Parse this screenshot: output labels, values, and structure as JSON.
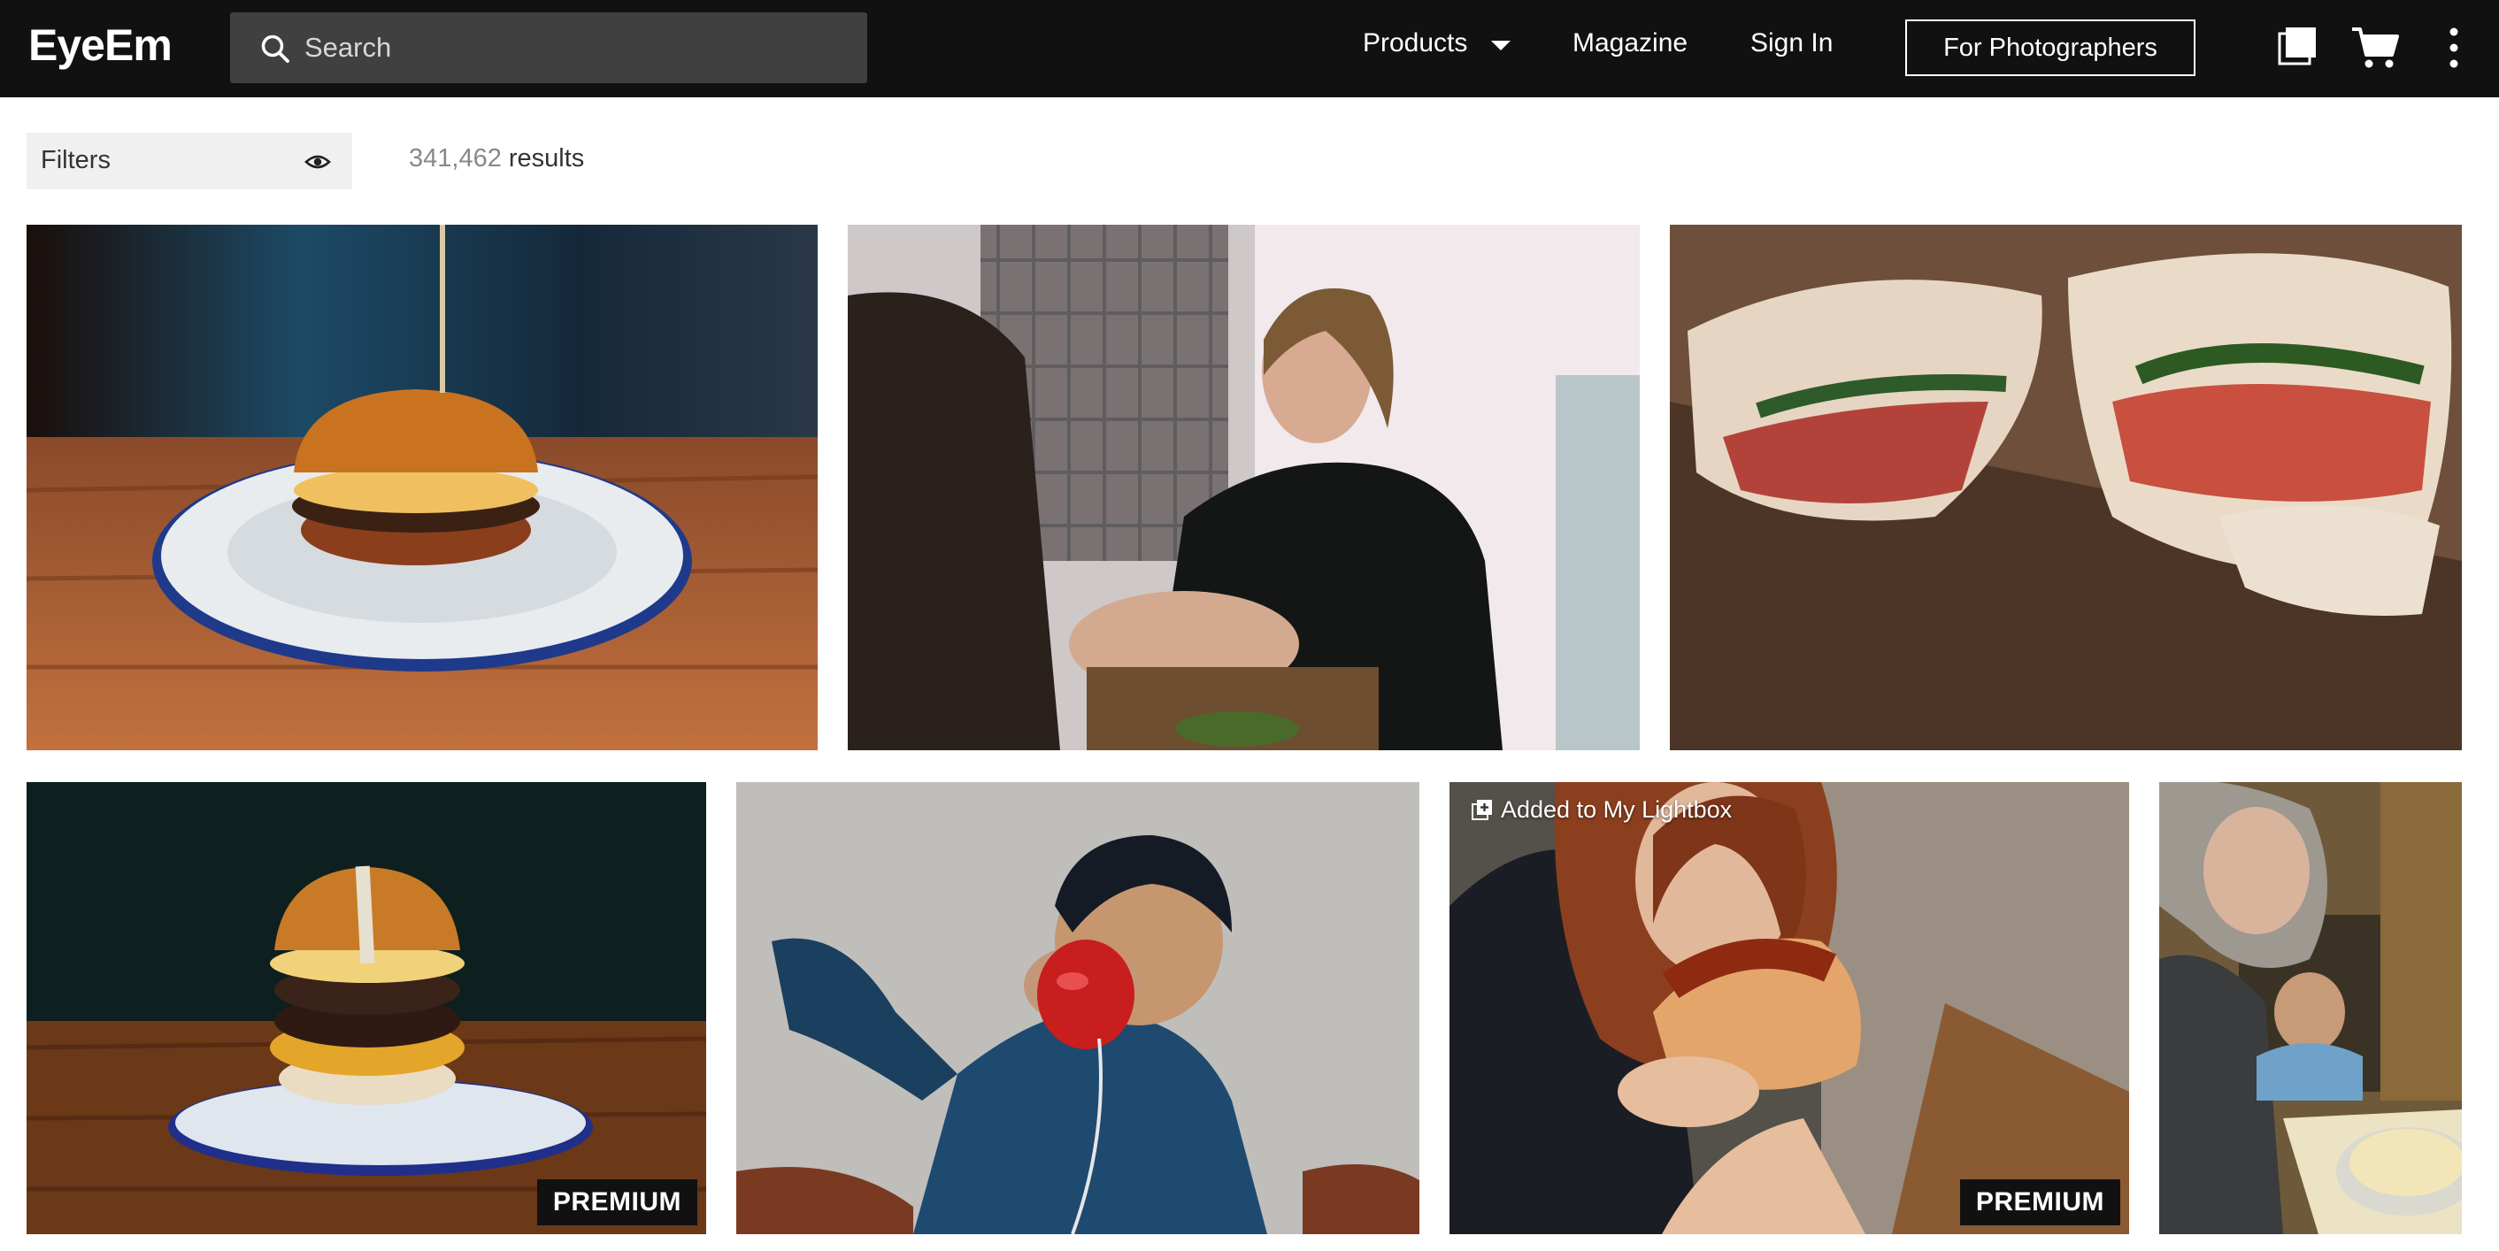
{
  "header": {
    "logo": "EyeEm",
    "search_placeholder": "Search",
    "nav": {
      "products": "Products",
      "magazine": "Magazine",
      "sign_in": "Sign In",
      "for_photographers": "For Photographers"
    },
    "icons": [
      "search-icon",
      "chevron-down-icon",
      "lightbox-icon",
      "cart-icon",
      "more-vertical-icon"
    ]
  },
  "toolbar": {
    "filters_label": "Filters",
    "results_count": "341,462",
    "results_word": "results"
  },
  "photos": [
    {
      "subject": "burger-on-enamel-plate",
      "badge": ""
    },
    {
      "subject": "woman-eating-in-cafe",
      "badge": ""
    },
    {
      "subject": "flatbread-sandwiches",
      "badge": ""
    },
    {
      "subject": "stacked-burger",
      "badge": "PREMIUM"
    },
    {
      "subject": "boy-holding-apple",
      "badge": ""
    },
    {
      "subject": "woman-eating-hotdog",
      "badge": "PREMIUM",
      "overlay": "Added to My Lightbox"
    },
    {
      "subject": "grandmother-cooking-with-child",
      "badge": ""
    }
  ],
  "colors": {
    "header_bg": "#111111",
    "search_bg": "#404040",
    "filters_bg": "#f0f0f0",
    "badge_bg": "#111111"
  }
}
